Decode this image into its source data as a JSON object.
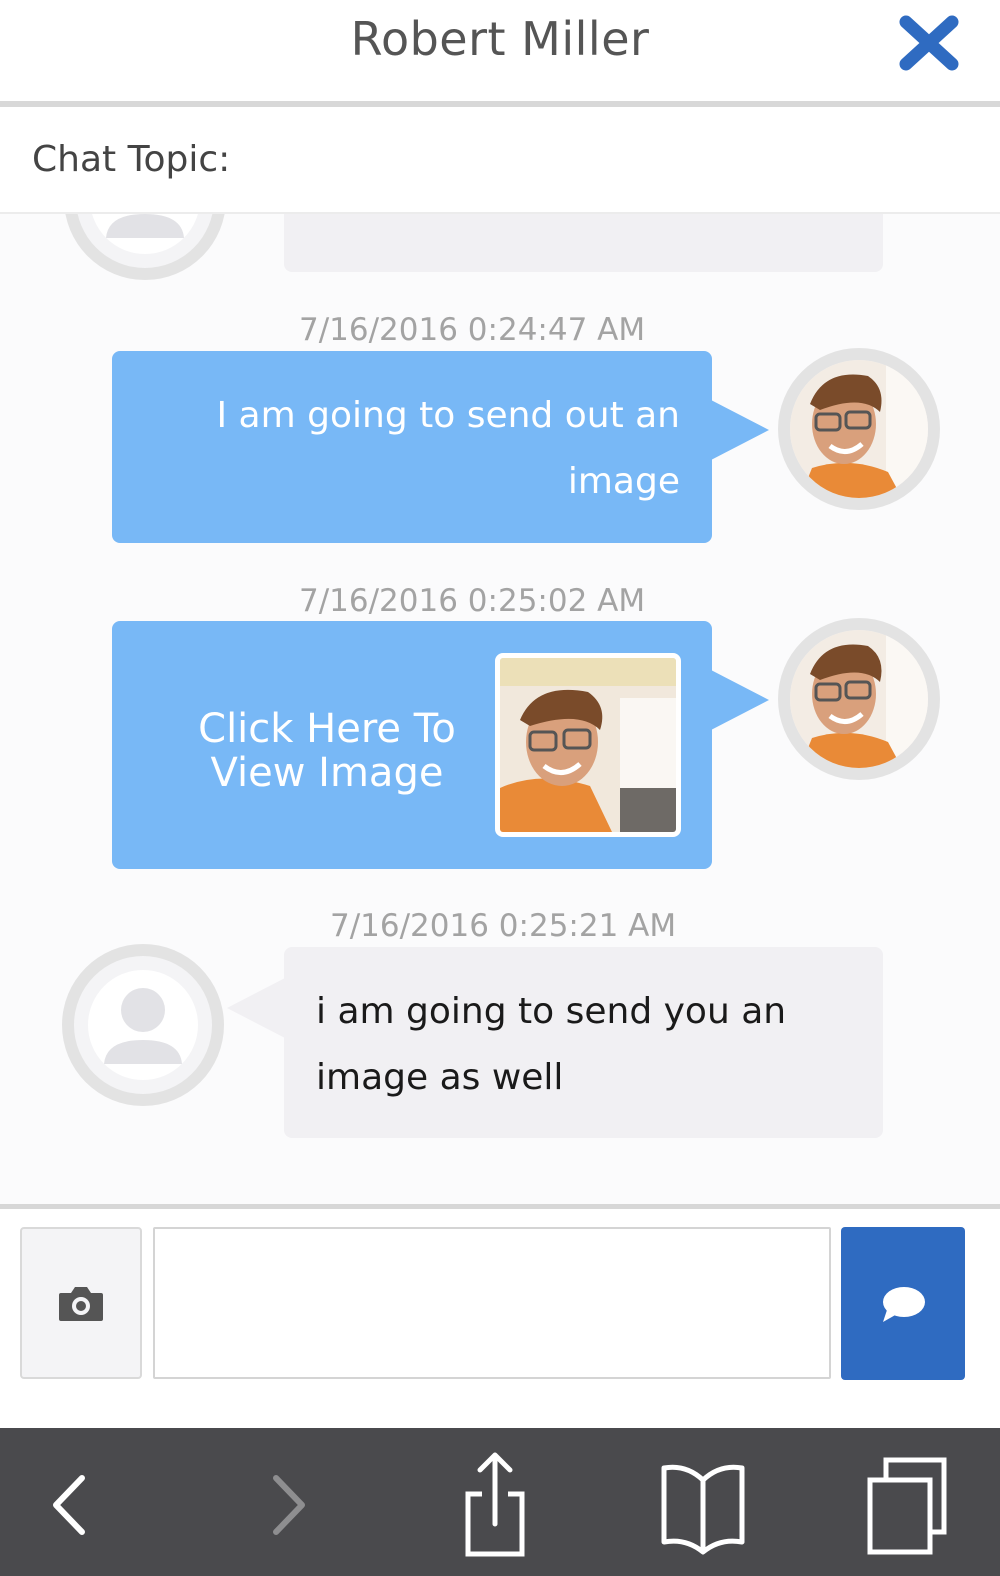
{
  "header": {
    "title": "Robert Miller",
    "close_icon": "close-x-icon",
    "accent_color": "#2f6bc1"
  },
  "topic": {
    "label": "Chat Topic:"
  },
  "messages": [
    {
      "side": "right",
      "timestamp": "7/16/2016 0:24:47 AM",
      "text": "I am going to send out an image",
      "avatar": "user-photo-avatar"
    },
    {
      "side": "right",
      "timestamp": "7/16/2016 0:25:02 AM",
      "text": "Click Here To View Image",
      "avatar": "user-photo-avatar",
      "attachment": "image-thumbnail"
    },
    {
      "side": "left",
      "timestamp": "7/16/2016 0:25:21 AM",
      "text": "i am going to send you an image as well",
      "avatar": "default-person-avatar"
    }
  ],
  "composer": {
    "input_value": "",
    "camera_icon": "camera-icon",
    "send_icon": "speech-bubble-icon"
  },
  "browser_toolbar": {
    "icons": [
      "back-arrow-icon",
      "forward-arrow-icon",
      "share-icon",
      "bookmarks-icon",
      "tabs-icon"
    ]
  },
  "colors": {
    "outgoing_bubble": "#78b8f6",
    "incoming_bubble": "#f1f0f3",
    "send_button": "#2f6bc1",
    "toolbar": "#4a4a4d"
  }
}
